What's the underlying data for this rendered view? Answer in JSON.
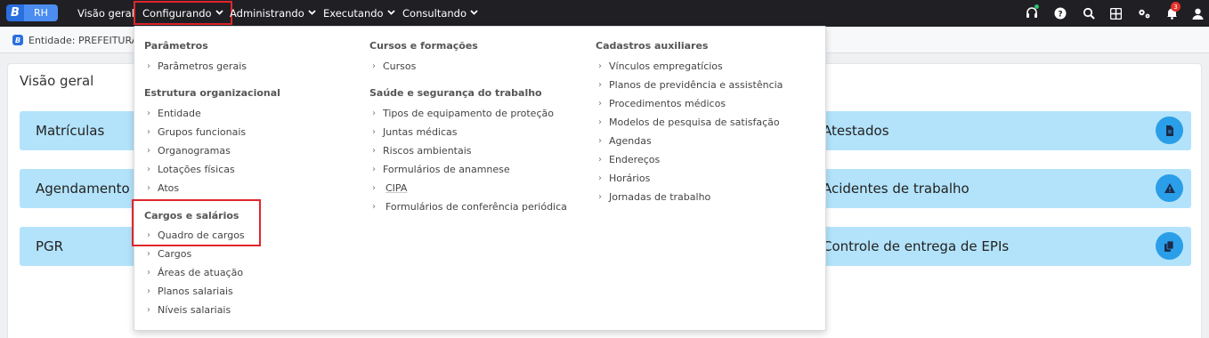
{
  "app": {
    "logo_letter": "B",
    "logo_text": "RH"
  },
  "nav": [
    {
      "label": "Visão geral",
      "has_chevron": false
    },
    {
      "label": "Configurando",
      "has_chevron": true,
      "selected": true
    },
    {
      "label": "Administrando",
      "has_chevron": true
    },
    {
      "label": "Executando",
      "has_chevron": true
    },
    {
      "label": "Consultando",
      "has_chevron": true
    }
  ],
  "topicons": [
    "headset-icon",
    "help-icon",
    "search-icon",
    "apps-grid-icon",
    "settings-icon",
    "bell-icon",
    "user-icon"
  ],
  "notifications": {
    "count": "3"
  },
  "entity": {
    "badge": "B",
    "text": "Entidade: PREFEITURA D"
  },
  "main": {
    "title": "Visão geral"
  },
  "cards": [
    {
      "label": "Matrículas",
      "icon": ""
    },
    {
      "label": "Agendamento",
      "icon": ""
    },
    {
      "label": "PGR",
      "icon": ""
    },
    {
      "label": "Atestados",
      "icon": "document-icon"
    },
    {
      "label": "Acidentes de trabalho",
      "icon": "warning-icon"
    },
    {
      "label": "Controle de entrega de EPIs",
      "icon": "copy-icon"
    }
  ],
  "menu": {
    "col1": [
      {
        "section": "Parâmetros",
        "items": [
          "Parâmetros gerais"
        ]
      },
      {
        "section": "Estrutura organizacional",
        "items": [
          "Entidade",
          "Grupos funcionais",
          "Organogramas",
          "Lotações físicas",
          "Atos"
        ]
      },
      {
        "section": "Cargos e salários",
        "items": [
          "Quadro de cargos",
          "Cargos",
          "Áreas de atuação",
          "Planos salariais",
          "Níveis salariais"
        ]
      }
    ],
    "col2": [
      {
        "section": "Cursos e formações",
        "items": [
          "Cursos"
        ]
      },
      {
        "section": "Saúde e segurança do trabalho",
        "items": [
          "Tipos de equipamento de proteção",
          "Juntas médicas",
          "Riscos ambientais",
          "Formulários de anamnese",
          "CIPA",
          "Formulários de conferência periódica"
        ]
      }
    ],
    "col3": [
      {
        "section": "Cadastros auxiliares",
        "items": [
          "Vínculos empregatícios",
          "Planos de previdência e assistência",
          "Procedimentos médicos",
          "Modelos de pesquisa de satisfação",
          "Agendas",
          "Endereços",
          "Horários",
          "Jornadas de trabalho"
        ]
      }
    ]
  },
  "colors": {
    "topbar": "#1f1f24",
    "card_bg": "#b3e3fb",
    "card_icon": "#2a9ee8",
    "highlight": "#e0262b",
    "brand": "#2a6fe0"
  }
}
